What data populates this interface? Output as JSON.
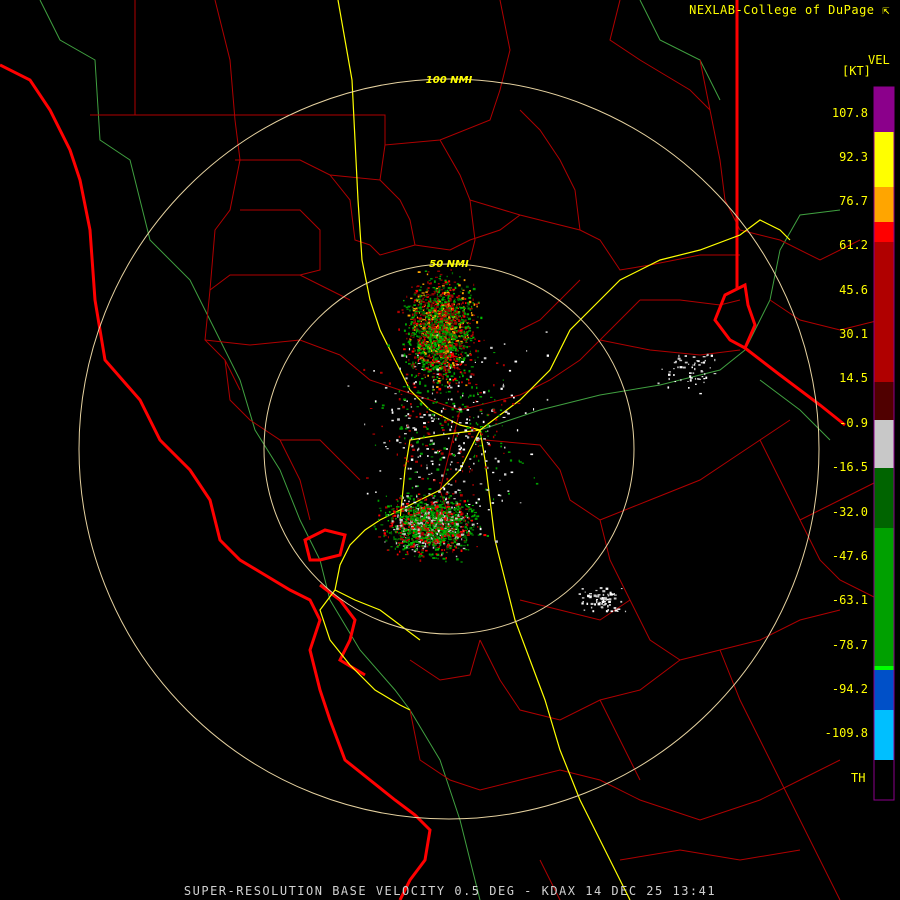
{
  "header": {
    "credit": "NEXLAB-College of DuPage"
  },
  "footer": {
    "caption": "SUPER-RESOLUTION BASE VELOCITY 0.5 DEG - KDAX 14 DEC 25 13:41"
  },
  "range_rings": [
    {
      "label": "50 NMI"
    },
    {
      "label": "100 NMI"
    }
  ],
  "legend": {
    "title": "VEL",
    "units": "[KT]",
    "values": [
      "107.8",
      "92.3",
      "76.7",
      "61.2",
      "45.6",
      "30.1",
      "14.5",
      "-0.9",
      "-16.5",
      "-32.0",
      "-47.6",
      "-63.1",
      "-78.7",
      "-94.2",
      "-109.8"
    ],
    "bottom_label": "TH",
    "colors": {
      "purple": "#8b008b",
      "yellow": "#ffff00",
      "orange": "#ffa500",
      "red": "#ff0000",
      "dark_red": "#8b0000",
      "gray": "#c8c8c8",
      "dark_green": "#006400",
      "green": "#00ff00",
      "blue": "#0064ff",
      "cyan": "#00bfff"
    }
  },
  "map_colors": {
    "state_border": "#ff0000",
    "county_border": "#b00000",
    "highway": "#ffff00",
    "rivers": "#40a040",
    "range_ring": "#e6d2a0"
  },
  "icons": [
    "external-link-icon"
  ]
}
